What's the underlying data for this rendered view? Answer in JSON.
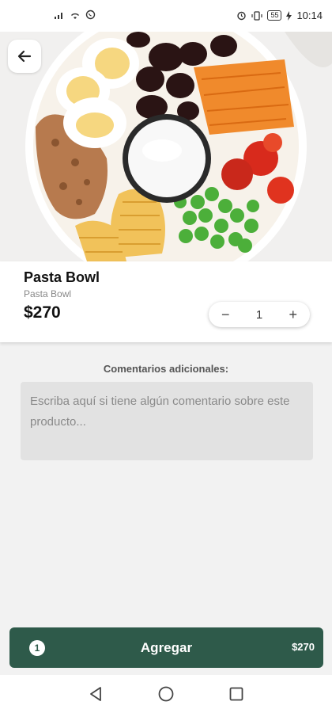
{
  "status_bar": {
    "time": "10:14",
    "battery": "55",
    "icons": [
      "signal-icon",
      "wifi-icon",
      "whatsapp-icon",
      "alarm-icon",
      "vibrate-icon",
      "battery-icon",
      "charging-icon"
    ]
  },
  "product": {
    "title": "Pasta Bowl",
    "subtitle": "Pasta Bowl",
    "price": "$270",
    "quantity": "1"
  },
  "comments": {
    "label": "Comentarios adicionales:",
    "placeholder": "Escriba aquí si tiene algún comentario sobre este producto..."
  },
  "cta": {
    "count": "1",
    "label": "Agregar",
    "price": "$270",
    "color": "#2e5a4a"
  },
  "nav": {
    "icons": [
      "back-icon",
      "home-icon",
      "recents-icon"
    ]
  }
}
